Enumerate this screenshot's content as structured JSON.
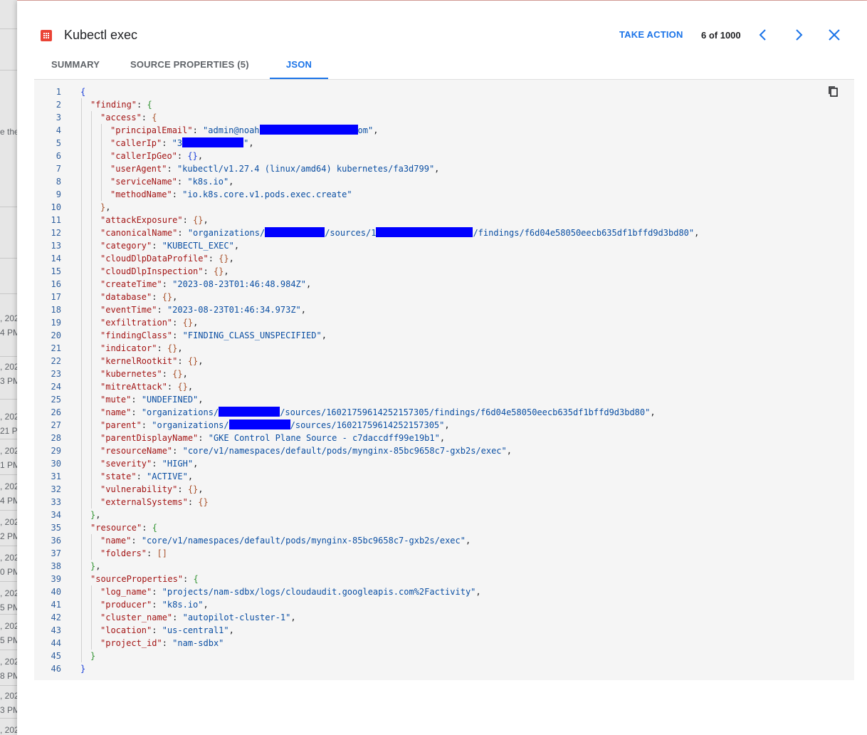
{
  "background": {
    "fragments": [
      "e the",
      ", 202",
      "4 PM",
      ", 202",
      "3 PM",
      ", 202",
      "21 PM",
      ", 202",
      "1 PM",
      ", 202",
      "4 PM",
      ", 202",
      "2 PM",
      ", 202",
      "0 PM",
      ", 202",
      "5 PM",
      ", 202",
      "5 PM",
      ", 202",
      "8 PM",
      ", 202",
      "3 PM",
      ", 202"
    ]
  },
  "header": {
    "icon": "finding-alert-icon",
    "title": "Kubectl exec",
    "take_action": "TAKE ACTION",
    "pager": "6 of 1000",
    "prev_icon": "chevron-left-icon",
    "next_icon": "chevron-right-icon",
    "close_icon": "close-icon"
  },
  "tabs": [
    {
      "label": "SUMMARY",
      "active": false
    },
    {
      "label": "SOURCE PROPERTIES (5)",
      "active": false
    },
    {
      "label": "JSON",
      "active": true
    }
  ],
  "colors": {
    "accent": "#1a73e8",
    "alert": "#ea4335",
    "key": "#a31515",
    "string": "#0b4fa3",
    "redaction": "#0000ff"
  },
  "code": {
    "copy_icon": "copy-icon",
    "lines": [
      {
        "n": "1",
        "indent": 0,
        "parts": [
          [
            "b0",
            "{"
          ]
        ]
      },
      {
        "n": "2",
        "indent": 1,
        "parts": [
          [
            "k",
            "\"finding\""
          ],
          [
            "p",
            ": "
          ],
          [
            "b1",
            "{"
          ]
        ]
      },
      {
        "n": "3",
        "indent": 2,
        "parts": [
          [
            "k",
            "\"access\""
          ],
          [
            "p",
            ": "
          ],
          [
            "b2",
            "{"
          ]
        ]
      },
      {
        "n": "4",
        "indent": 3,
        "parts": [
          [
            "k",
            "\"principalEmail\""
          ],
          [
            "p",
            ": "
          ],
          [
            "s",
            "\"admin@noah"
          ],
          [
            "r",
            138
          ],
          [
            "s",
            "om\""
          ],
          [
            "p",
            ","
          ]
        ]
      },
      {
        "n": "5",
        "indent": 3,
        "parts": [
          [
            "k",
            "\"callerIp\""
          ],
          [
            "p",
            ": "
          ],
          [
            "s",
            "\"3"
          ],
          [
            "r",
            86
          ],
          [
            "s",
            "\""
          ],
          [
            "p",
            ","
          ]
        ]
      },
      {
        "n": "6",
        "indent": 3,
        "parts": [
          [
            "k",
            "\"callerIpGeo\""
          ],
          [
            "p",
            ": "
          ],
          [
            "b0",
            "{}"
          ],
          [
            "p",
            ","
          ]
        ]
      },
      {
        "n": "7",
        "indent": 3,
        "parts": [
          [
            "k",
            "\"userAgent\""
          ],
          [
            "p",
            ": "
          ],
          [
            "s",
            "\"kubectl/v1.27.4 (linux/amd64) kubernetes/fa3d799\""
          ],
          [
            "p",
            ","
          ]
        ]
      },
      {
        "n": "8",
        "indent": 3,
        "parts": [
          [
            "k",
            "\"serviceName\""
          ],
          [
            "p",
            ": "
          ],
          [
            "s",
            "\"k8s.io\""
          ],
          [
            "p",
            ","
          ]
        ]
      },
      {
        "n": "9",
        "indent": 3,
        "parts": [
          [
            "k",
            "\"methodName\""
          ],
          [
            "p",
            ": "
          ],
          [
            "s",
            "\"io.k8s.core.v1.pods.exec.create\""
          ]
        ]
      },
      {
        "n": "10",
        "indent": 2,
        "parts": [
          [
            "b2",
            "}"
          ],
          [
            "p",
            ","
          ]
        ]
      },
      {
        "n": "11",
        "indent": 2,
        "parts": [
          [
            "k",
            "\"attackExposure\""
          ],
          [
            "p",
            ": "
          ],
          [
            "b2",
            "{}"
          ],
          [
            "p",
            ","
          ]
        ]
      },
      {
        "n": "12",
        "indent": 2,
        "parts": [
          [
            "k",
            "\"canonicalName\""
          ],
          [
            "p",
            ": "
          ],
          [
            "s",
            "\"organizations/"
          ],
          [
            "r",
            84
          ],
          [
            "s",
            "/sources/1"
          ],
          [
            "r",
            136
          ],
          [
            "s",
            "/findings/f6d04e58050eecb635df1bffd9d3bd80\""
          ],
          [
            "p",
            ","
          ]
        ]
      },
      {
        "n": "13",
        "indent": 2,
        "parts": [
          [
            "k",
            "\"category\""
          ],
          [
            "p",
            ": "
          ],
          [
            "s",
            "\"KUBECTL_EXEC\""
          ],
          [
            "p",
            ","
          ]
        ]
      },
      {
        "n": "14",
        "indent": 2,
        "parts": [
          [
            "k",
            "\"cloudDlpDataProfile\""
          ],
          [
            "p",
            ": "
          ],
          [
            "b2",
            "{}"
          ],
          [
            "p",
            ","
          ]
        ]
      },
      {
        "n": "15",
        "indent": 2,
        "parts": [
          [
            "k",
            "\"cloudDlpInspection\""
          ],
          [
            "p",
            ": "
          ],
          [
            "b2",
            "{}"
          ],
          [
            "p",
            ","
          ]
        ]
      },
      {
        "n": "16",
        "indent": 2,
        "parts": [
          [
            "k",
            "\"createTime\""
          ],
          [
            "p",
            ": "
          ],
          [
            "s",
            "\"2023-08-23T01:46:48.984Z\""
          ],
          [
            "p",
            ","
          ]
        ]
      },
      {
        "n": "17",
        "indent": 2,
        "parts": [
          [
            "k",
            "\"database\""
          ],
          [
            "p",
            ": "
          ],
          [
            "b2",
            "{}"
          ],
          [
            "p",
            ","
          ]
        ]
      },
      {
        "n": "18",
        "indent": 2,
        "parts": [
          [
            "k",
            "\"eventTime\""
          ],
          [
            "p",
            ": "
          ],
          [
            "s",
            "\"2023-08-23T01:46:34.973Z\""
          ],
          [
            "p",
            ","
          ]
        ]
      },
      {
        "n": "19",
        "indent": 2,
        "parts": [
          [
            "k",
            "\"exfiltration\""
          ],
          [
            "p",
            ": "
          ],
          [
            "b2",
            "{}"
          ],
          [
            "p",
            ","
          ]
        ]
      },
      {
        "n": "20",
        "indent": 2,
        "parts": [
          [
            "k",
            "\"findingClass\""
          ],
          [
            "p",
            ": "
          ],
          [
            "s",
            "\"FINDING_CLASS_UNSPECIFIED\""
          ],
          [
            "p",
            ","
          ]
        ]
      },
      {
        "n": "21",
        "indent": 2,
        "parts": [
          [
            "k",
            "\"indicator\""
          ],
          [
            "p",
            ": "
          ],
          [
            "b2",
            "{}"
          ],
          [
            "p",
            ","
          ]
        ]
      },
      {
        "n": "22",
        "indent": 2,
        "parts": [
          [
            "k",
            "\"kernelRootkit\""
          ],
          [
            "p",
            ": "
          ],
          [
            "b2",
            "{}"
          ],
          [
            "p",
            ","
          ]
        ]
      },
      {
        "n": "23",
        "indent": 2,
        "parts": [
          [
            "k",
            "\"kubernetes\""
          ],
          [
            "p",
            ": "
          ],
          [
            "b2",
            "{}"
          ],
          [
            "p",
            ","
          ]
        ]
      },
      {
        "n": "24",
        "indent": 2,
        "parts": [
          [
            "k",
            "\"mitreAttack\""
          ],
          [
            "p",
            ": "
          ],
          [
            "b2",
            "{}"
          ],
          [
            "p",
            ","
          ]
        ]
      },
      {
        "n": "25",
        "indent": 2,
        "parts": [
          [
            "k",
            "\"mute\""
          ],
          [
            "p",
            ": "
          ],
          [
            "s",
            "\"UNDEFINED\""
          ],
          [
            "p",
            ","
          ]
        ]
      },
      {
        "n": "26",
        "indent": 2,
        "parts": [
          [
            "k",
            "\"name\""
          ],
          [
            "p",
            ": "
          ],
          [
            "s",
            "\"organizations/"
          ],
          [
            "r",
            86
          ],
          [
            "s",
            "/sources/16021759614252157305/findings/f6d04e58050eecb635df1bffd9d3bd80\""
          ],
          [
            "p",
            ","
          ]
        ]
      },
      {
        "n": "27",
        "indent": 2,
        "parts": [
          [
            "k",
            "\"parent\""
          ],
          [
            "p",
            ": "
          ],
          [
            "s",
            "\"organizations/"
          ],
          [
            "r",
            86
          ],
          [
            "s",
            "/sources/16021759614252157305\""
          ],
          [
            "p",
            ","
          ]
        ]
      },
      {
        "n": "28",
        "indent": 2,
        "parts": [
          [
            "k",
            "\"parentDisplayName\""
          ],
          [
            "p",
            ": "
          ],
          [
            "s",
            "\"GKE Control Plane Source - c7daccdff99e19b1\""
          ],
          [
            "p",
            ","
          ]
        ]
      },
      {
        "n": "29",
        "indent": 2,
        "parts": [
          [
            "k",
            "\"resourceName\""
          ],
          [
            "p",
            ": "
          ],
          [
            "s",
            "\"core/v1/namespaces/default/pods/mynginx-85bc9658c7-gxb2s/exec\""
          ],
          [
            "p",
            ","
          ]
        ]
      },
      {
        "n": "30",
        "indent": 2,
        "parts": [
          [
            "k",
            "\"severity\""
          ],
          [
            "p",
            ": "
          ],
          [
            "s",
            "\"HIGH\""
          ],
          [
            "p",
            ","
          ]
        ]
      },
      {
        "n": "31",
        "indent": 2,
        "parts": [
          [
            "k",
            "\"state\""
          ],
          [
            "p",
            ": "
          ],
          [
            "s",
            "\"ACTIVE\""
          ],
          [
            "p",
            ","
          ]
        ]
      },
      {
        "n": "32",
        "indent": 2,
        "parts": [
          [
            "k",
            "\"vulnerability\""
          ],
          [
            "p",
            ": "
          ],
          [
            "b2",
            "{}"
          ],
          [
            "p",
            ","
          ]
        ]
      },
      {
        "n": "33",
        "indent": 2,
        "parts": [
          [
            "k",
            "\"externalSystems\""
          ],
          [
            "p",
            ": "
          ],
          [
            "b2",
            "{}"
          ]
        ]
      },
      {
        "n": "34",
        "indent": 1,
        "parts": [
          [
            "b1",
            "}"
          ],
          [
            "p",
            ","
          ]
        ]
      },
      {
        "n": "35",
        "indent": 1,
        "parts": [
          [
            "k",
            "\"resource\""
          ],
          [
            "p",
            ": "
          ],
          [
            "b1",
            "{"
          ]
        ]
      },
      {
        "n": "36",
        "indent": 2,
        "parts": [
          [
            "k",
            "\"name\""
          ],
          [
            "p",
            ": "
          ],
          [
            "s",
            "\"core/v1/namespaces/default/pods/mynginx-85bc9658c7-gxb2s/exec\""
          ],
          [
            "p",
            ","
          ]
        ]
      },
      {
        "n": "37",
        "indent": 2,
        "parts": [
          [
            "k",
            "\"folders\""
          ],
          [
            "p",
            ": "
          ],
          [
            "b2",
            "[]"
          ]
        ]
      },
      {
        "n": "38",
        "indent": 1,
        "parts": [
          [
            "b1",
            "}"
          ],
          [
            "p",
            ","
          ]
        ]
      },
      {
        "n": "39",
        "indent": 1,
        "parts": [
          [
            "k",
            "\"sourceProperties\""
          ],
          [
            "p",
            ": "
          ],
          [
            "b1",
            "{"
          ]
        ]
      },
      {
        "n": "40",
        "indent": 2,
        "parts": [
          [
            "k",
            "\"log_name\""
          ],
          [
            "p",
            ": "
          ],
          [
            "s",
            "\"projects/nam-sdbx/logs/cloudaudit.googleapis.com%2Factivity\""
          ],
          [
            "p",
            ","
          ]
        ]
      },
      {
        "n": "41",
        "indent": 2,
        "parts": [
          [
            "k",
            "\"producer\""
          ],
          [
            "p",
            ": "
          ],
          [
            "s",
            "\"k8s.io\""
          ],
          [
            "p",
            ","
          ]
        ]
      },
      {
        "n": "42",
        "indent": 2,
        "parts": [
          [
            "k",
            "\"cluster_name\""
          ],
          [
            "p",
            ": "
          ],
          [
            "s",
            "\"autopilot-cluster-1\""
          ],
          [
            "p",
            ","
          ]
        ]
      },
      {
        "n": "43",
        "indent": 2,
        "parts": [
          [
            "k",
            "\"location\""
          ],
          [
            "p",
            ": "
          ],
          [
            "s",
            "\"us-central1\""
          ],
          [
            "p",
            ","
          ]
        ]
      },
      {
        "n": "44",
        "indent": 2,
        "parts": [
          [
            "k",
            "\"project_id\""
          ],
          [
            "p",
            ": "
          ],
          [
            "s",
            "\"nam-sdbx\""
          ]
        ]
      },
      {
        "n": "45",
        "indent": 1,
        "parts": [
          [
            "b1",
            "}"
          ]
        ]
      },
      {
        "n": "46",
        "indent": 0,
        "parts": [
          [
            "b0",
            "}"
          ]
        ]
      }
    ]
  }
}
